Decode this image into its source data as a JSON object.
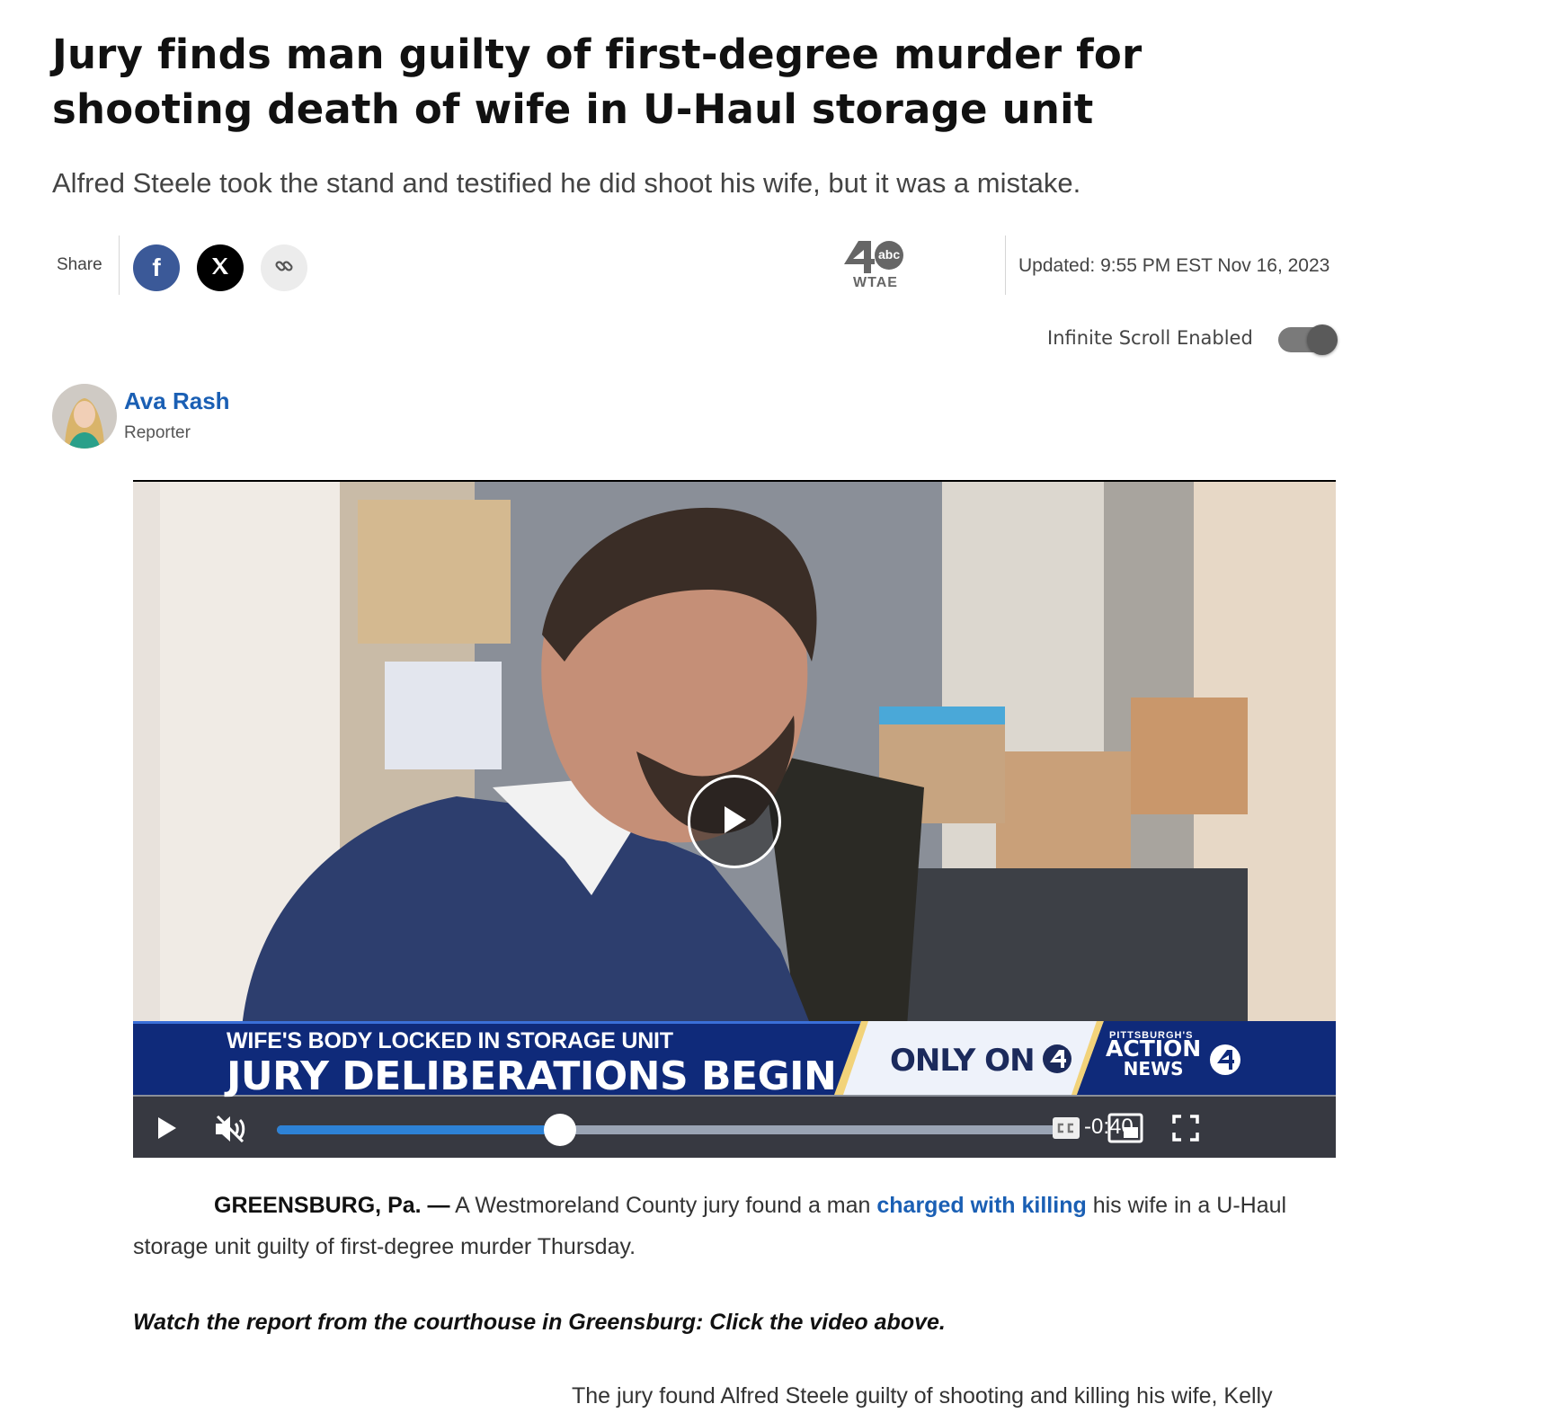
{
  "article": {
    "headline": "Jury finds man guilty of first-degree murder for shooting death of wife in U-Haul storage unit",
    "dek": "Alfred Steele took the stand and testified he did shoot his wife, but it was a mistake."
  },
  "share": {
    "label": "Share",
    "buttons": [
      {
        "name": "facebook",
        "icon": "facebook-icon",
        "glyph": "f"
      },
      {
        "name": "x",
        "icon": "x-icon",
        "glyph": "X"
      },
      {
        "name": "copy-link",
        "icon": "link-icon"
      }
    ]
  },
  "station": {
    "logo_text": "WTAE",
    "logo_badge": "abc"
  },
  "updated": "Updated: 9:55 PM EST Nov 16, 2023",
  "infinite_scroll": {
    "label": "Infinite Scroll Enabled",
    "enabled": true
  },
  "author": {
    "name": "Ava Rash",
    "role": "Reporter"
  },
  "video": {
    "lower_third": {
      "top_line": "WIFE'S BODY LOCKED IN STORAGE UNIT",
      "main_line": "JURY DELIBERATIONS BEGIN",
      "only_on": "ONLY ON",
      "brand_top": "PITTSBURGH'S",
      "brand_line1": "ACTION",
      "brand_line2": "NEWS"
    },
    "time_remaining": "-0:40",
    "progress_fraction": 0.36,
    "muted": true,
    "controls": [
      "play-icon",
      "muted-icon",
      "closed-captions-icon",
      "picture-in-picture-icon",
      "fullscreen-icon"
    ],
    "colors": {
      "lower_third_blue": "#0f2a7a",
      "progress_fill": "#2d82d6"
    }
  },
  "body": {
    "p1_dateline": "GREENSBURG, Pa. —",
    "p1_before_link": "A Westmoreland County jury found a man",
    "p1_link": "charged with killing",
    "p1_after_link": "his wife in a U-Haul storage unit guilty of first-degree murder Thursday.",
    "p2": "Watch the report from the courthouse in Greensburg: Click the video above.",
    "p3": "The jury found Alfred Steele guilty of shooting and killing his wife, Kelly"
  },
  "colors": {
    "link": "#1a5fb4",
    "facebook": "#3b5998"
  }
}
